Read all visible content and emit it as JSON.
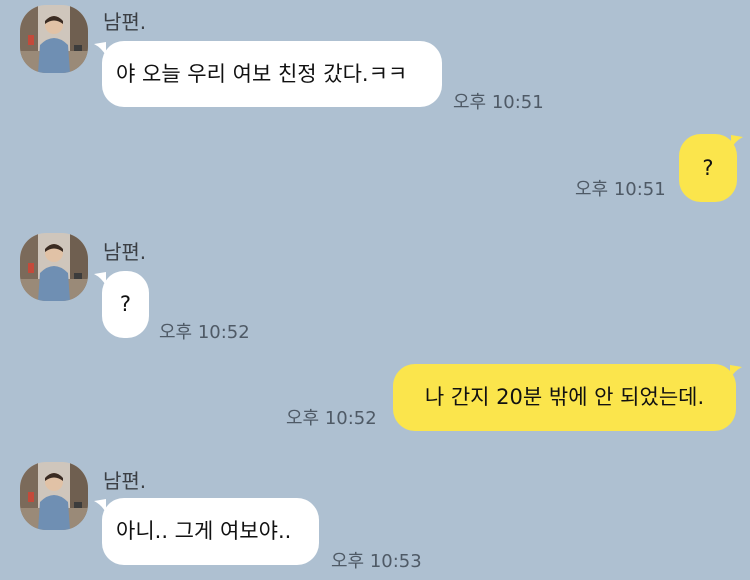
{
  "messages": [
    {
      "sender": "남편.",
      "text": "야 오늘 우리 여보 친정 갔다.ㅋㅋ",
      "time": "오후 10:51"
    },
    {
      "text": "?",
      "time": "오후 10:51"
    },
    {
      "sender": "남편.",
      "text": "?",
      "time": "오후 10:52"
    },
    {
      "text": "나 간지 20분 밖에 안 되었는데.",
      "time": "오후 10:52"
    },
    {
      "sender": "남편.",
      "text": "아니.. 그게 여보야..",
      "time": "오후 10:53"
    }
  ],
  "colors": {
    "background": "#aec0d1",
    "incoming_bubble": "#ffffff",
    "outgoing_bubble": "#fbe54c"
  },
  "icons": {
    "avatar": "profile-photo"
  }
}
